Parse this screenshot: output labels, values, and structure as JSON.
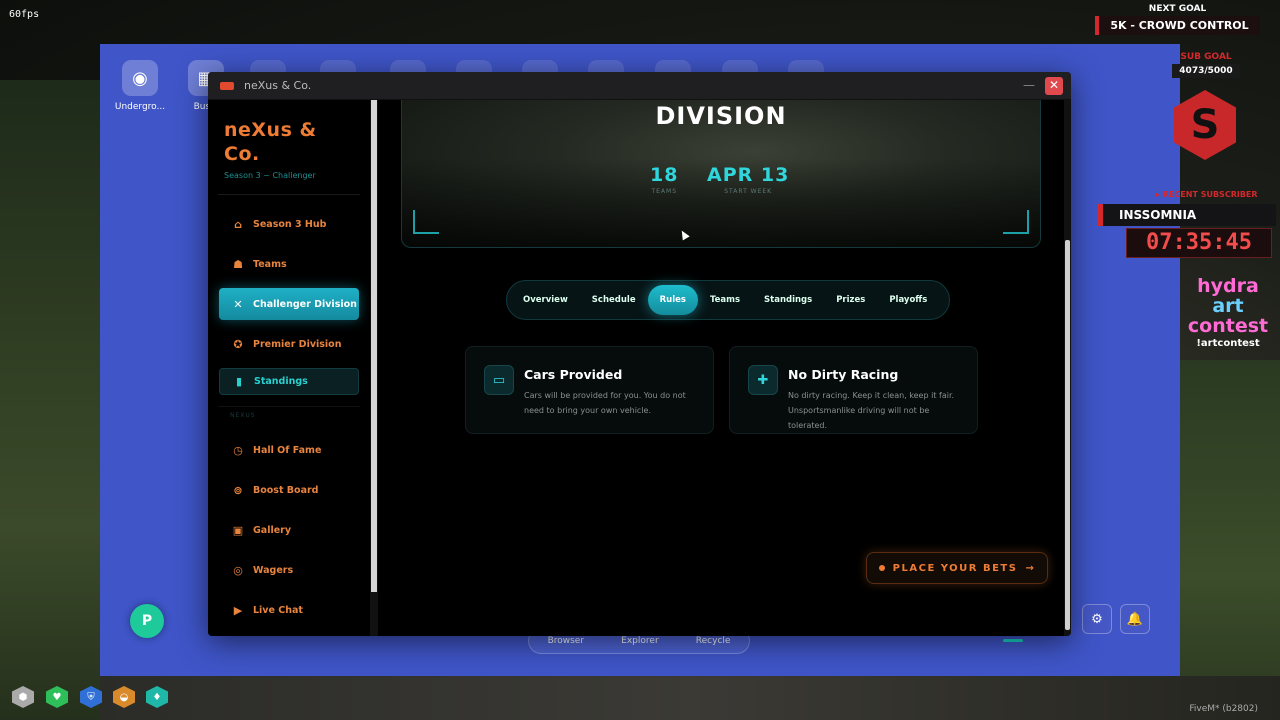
{
  "overlay": {
    "fps": "60fps",
    "next_goal_label": "NEXT GOAL",
    "next_goal_value": "5K - CROWD CONTROL",
    "sub_goal_label": "SUB GOAL",
    "sub_goal_value": "4073/5000",
    "recent_subscriber_label": "▸ RECENT SUBSCRIBER",
    "recent_subscriber_name": "INSSOMNIA",
    "timer": "07:35:45",
    "contest_word1": "hydra",
    "contest_word2": "art",
    "contest_word3": "contest",
    "contest_command": "!artcontest",
    "build": "FiveM* (b2802)"
  },
  "desktop": {
    "icons": [
      {
        "label": "Undergro...",
        "icon": "turbo-icon"
      },
      {
        "label": "Busin",
        "icon": "grid-icon"
      }
    ],
    "taskbar": [
      "Browser",
      "Explorer",
      "Recycle"
    ]
  },
  "window": {
    "title": "neXus & Co.",
    "minimize_glyph": "—",
    "close_glyph": "✕"
  },
  "sidebar": {
    "brand_name": "neXus & Co.",
    "brand_sub": "Season 3 ~ Challenger",
    "section_label": "NEXUS",
    "items": [
      {
        "label": "Season 3 Hub",
        "icon": "home-icon",
        "glyph": "⌂"
      },
      {
        "label": "Teams",
        "icon": "people-icon",
        "glyph": "☗"
      },
      {
        "label": "Challenger Division",
        "icon": "crossed-swords-icon",
        "glyph": "✕"
      },
      {
        "label": "Premier Division",
        "icon": "medal-icon",
        "glyph": "✪"
      },
      {
        "label": "Standings",
        "icon": "bar-chart-icon",
        "glyph": "▮"
      },
      {
        "label": "Hall Of Fame",
        "icon": "history-icon",
        "glyph": "◷"
      },
      {
        "label": "Boost Board",
        "icon": "steering-wheel-icon",
        "glyph": "⊚"
      },
      {
        "label": "Gallery",
        "icon": "image-icon",
        "glyph": "▣"
      },
      {
        "label": "Wagers",
        "icon": "coin-icon",
        "glyph": "◎"
      },
      {
        "label": "Live Chat",
        "icon": "video-icon",
        "glyph": "▶"
      }
    ]
  },
  "hero": {
    "heading": "DIVISION",
    "stats": [
      {
        "value": "18",
        "caption": "TEAMS"
      },
      {
        "value": "APR 13",
        "caption": "START WEEK"
      }
    ]
  },
  "tabs": {
    "items": [
      "Overview",
      "Schedule",
      "Rules",
      "Teams",
      "Standings",
      "Prizes",
      "Playoffs"
    ],
    "active": "Rules"
  },
  "rules": [
    {
      "title": "Cars Provided",
      "icon": "car-icon",
      "glyph": "🚘",
      "line1": "Cars will be provided for you. You do not",
      "line2": "need to bring your own vehicle."
    },
    {
      "title": "No Dirty Racing",
      "icon": "shield-plus-icon",
      "glyph": "⛨",
      "line1": "No dirty racing. Keep it clean, keep it fair.",
      "line2": "Unsportsmanlike driving will not be tolerated."
    }
  ],
  "cta": {
    "label": "PLACE YOUR BETS",
    "arrow": "→"
  },
  "colors": {
    "accent_orange": "#ee7c35",
    "accent_teal": "#1fb0c6",
    "desktop_blue": "#3f55c8",
    "overlay_red": "#d4282d"
  }
}
